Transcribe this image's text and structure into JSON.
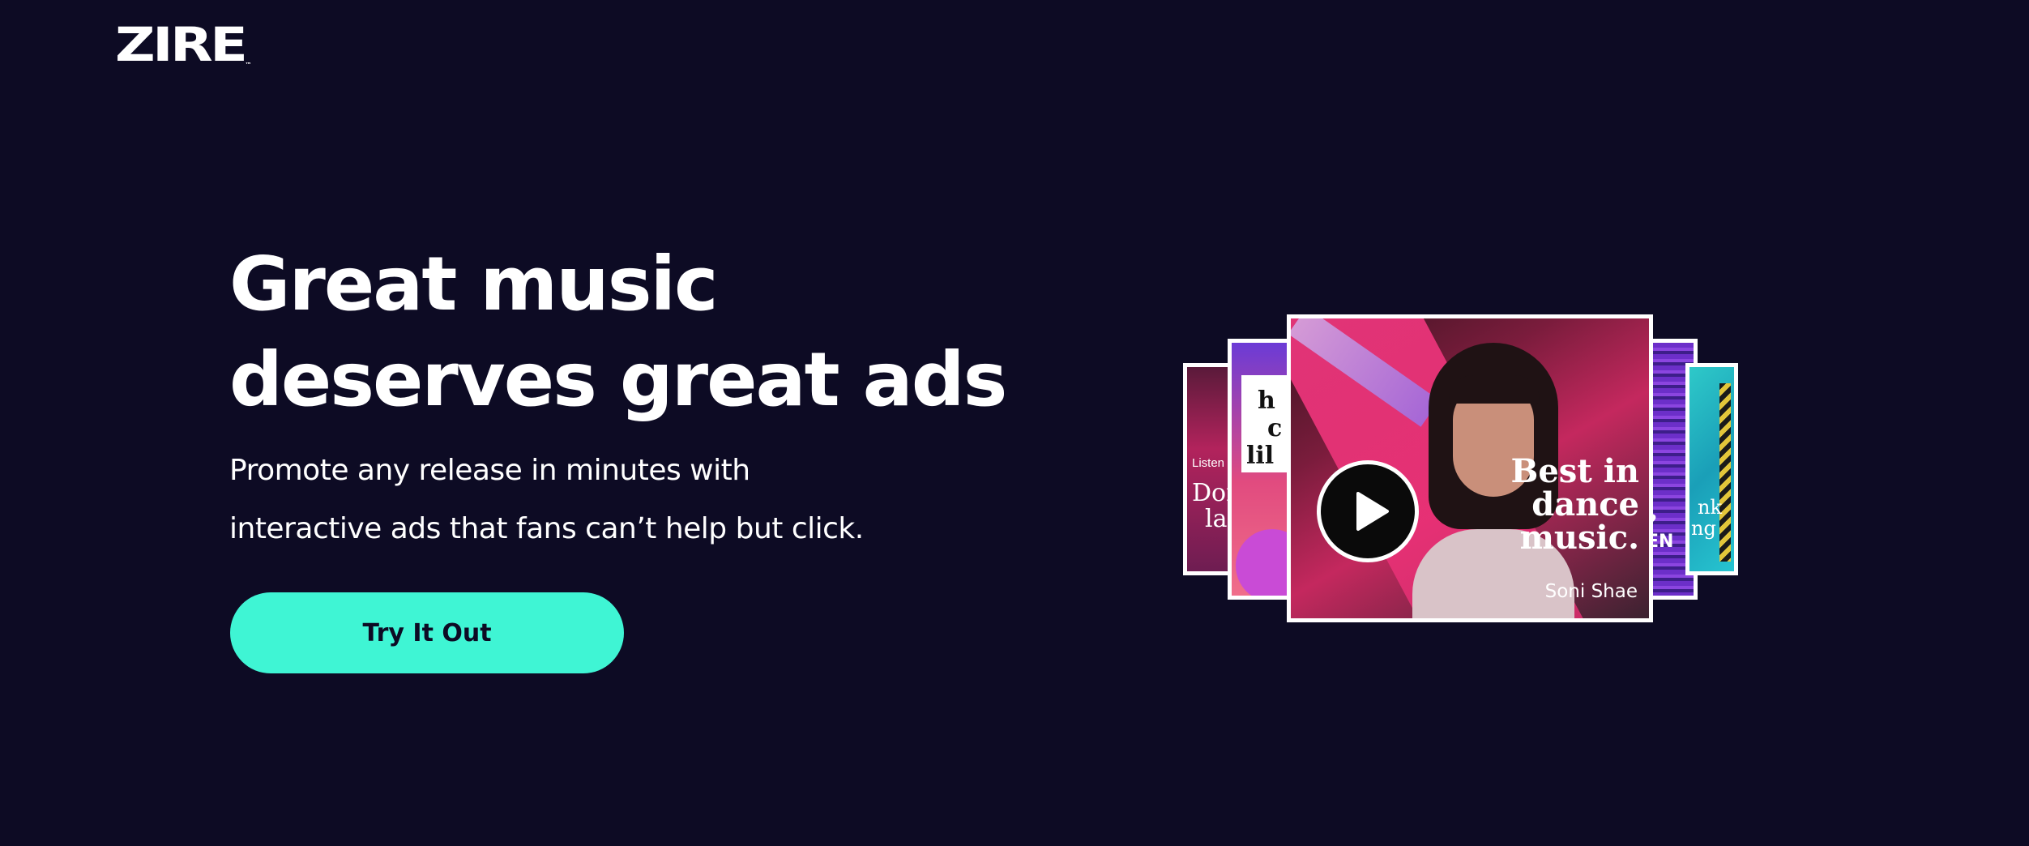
{
  "brand": {
    "logo_text": "ZIRE",
    "logo_mark": "™"
  },
  "hero": {
    "title_lines": [
      "Great music",
      "deserves great ads"
    ],
    "subtitle_lines": [
      "Promote any release in minutes with",
      "interactive ads that fans can’t help but click."
    ],
    "cta_label": "Try It Out"
  },
  "ad_preview": {
    "main_card": {
      "headline_lines": [
        "Best in",
        "dance",
        "music."
      ],
      "artist": "Soni Shae",
      "play_icon": "play-icon"
    },
    "back_left_2": {
      "label": "Listen",
      "text_lines": [
        "Dor",
        "la"
      ]
    },
    "back_left_1": {
      "text_lines": [
        "h",
        "c",
        "lil"
      ]
    },
    "back_right_1": {
      "text_lines": [
        "?",
        "EN"
      ]
    },
    "back_right_2": {
      "text_lines": [
        "nk",
        "ng"
      ]
    }
  },
  "colors": {
    "background": "#0d0b24",
    "accent": "#3ff5d4",
    "text": "#ffffff"
  }
}
